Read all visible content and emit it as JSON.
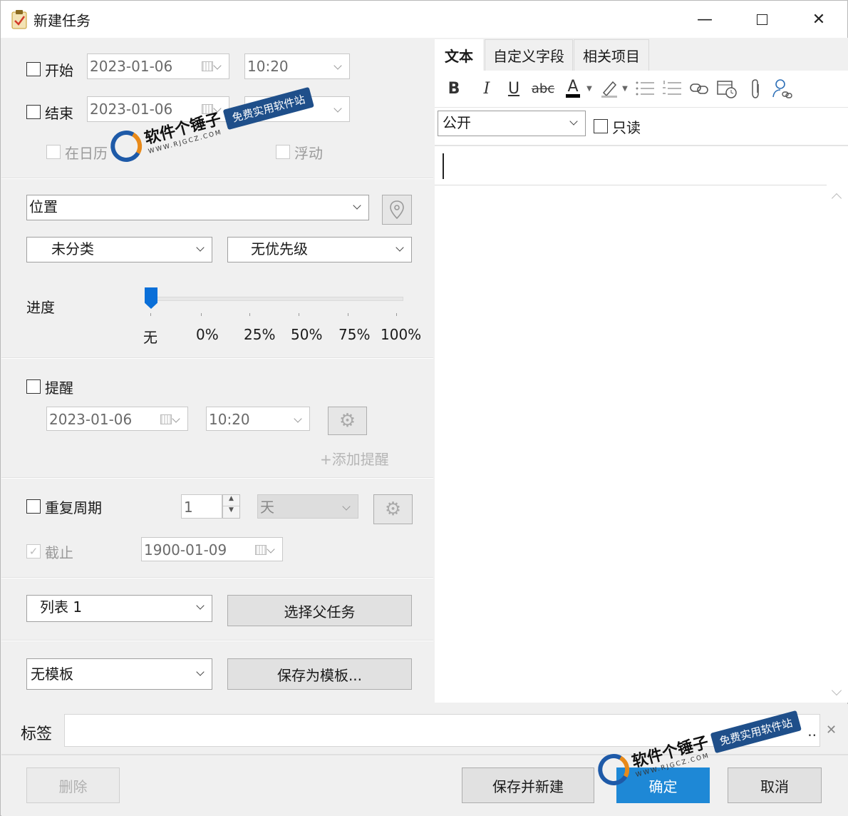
{
  "window": {
    "title": "新建任务"
  },
  "schedule": {
    "start_label": "开始",
    "start_date": "2023-01-06",
    "start_time": "10:20",
    "end_label": "结束",
    "end_date": "2023-01-06",
    "in_calendar_label": "在日历",
    "float_label": "浮动"
  },
  "details": {
    "location_placeholder": "位置",
    "category": "未分类",
    "priority": "无优先级",
    "progress_label": "进度",
    "progress_ticks": [
      "无",
      "0%",
      "25%",
      "50%",
      "75%",
      "100%"
    ],
    "progress_value": "无"
  },
  "reminder": {
    "label": "提醒",
    "date": "2023-01-06",
    "time": "10:20",
    "add_label": "+添加提醒"
  },
  "recurrence": {
    "label": "重复周期",
    "interval": "1",
    "unit": "天",
    "until_label": "截止",
    "until_date": "1900-01-09"
  },
  "list": {
    "value": "列表 1",
    "parent_button": "选择父任务"
  },
  "template": {
    "value": "无模板",
    "save_button": "保存为模板..."
  },
  "editor": {
    "tabs": [
      "文本",
      "自定义字段",
      "相关项目"
    ],
    "active_tab": "文本",
    "visibility": "公开",
    "readonly_label": "只读",
    "toolbar": {
      "bold": "B",
      "italic": "I",
      "underline": "U",
      "strike": "abc",
      "font_color": "A"
    }
  },
  "tags": {
    "label": "标签",
    "overflow": ".."
  },
  "footer": {
    "delete": "删除",
    "save_new": "保存并新建",
    "ok": "确定",
    "cancel": "取消"
  },
  "watermark": {
    "brand": "软件个锤子",
    "domain": "WWW.RJGCZ.COM",
    "tagline": "免费实用软件站"
  },
  "colors": {
    "accent": "#0a6fd8",
    "ok_button": "#1e88d6"
  }
}
